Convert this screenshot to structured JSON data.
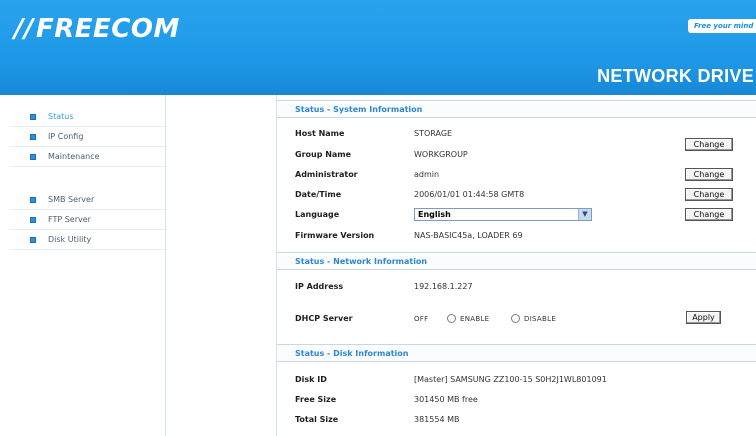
{
  "header": {
    "logo": "FREECOM",
    "tagline": "Free your mind",
    "product": "NETWORK DRIVE",
    "colors": {
      "brand_blue": "#1f9ae8",
      "header_text": "#ffffff"
    }
  },
  "sidebar": {
    "groups": [
      {
        "items": [
          {
            "label": "Status",
            "active": true
          },
          {
            "label": "IP Config",
            "active": false
          },
          {
            "label": "Maintenance",
            "active": false
          }
        ]
      },
      {
        "items": [
          {
            "label": "SMB Server",
            "active": false
          },
          {
            "label": "FTP Server",
            "active": false
          },
          {
            "label": "Disk Utility",
            "active": false
          }
        ]
      }
    ]
  },
  "system": {
    "title": "Status - System Information",
    "host_name": {
      "label": "Host Name",
      "value": "STORAGE",
      "button": "Change"
    },
    "group_name": {
      "label": "Group Name",
      "value": "WORKGROUP"
    },
    "administrator": {
      "label": "Administrator",
      "value": "admin",
      "button": "Change"
    },
    "datetime": {
      "label": "Date/Time",
      "value": "2006/01/01 01:44:58 GMT8",
      "button": "Change"
    },
    "language": {
      "label": "Language",
      "value": "English",
      "button": "Change"
    },
    "firmware": {
      "label": "Firmware Version",
      "value": "NAS-BASIC45a, LOADER 69"
    }
  },
  "network": {
    "title": "Status - Network Information",
    "ip": {
      "label": "IP Address",
      "value": "192.168.1.227"
    },
    "dhcp": {
      "label": "DHCP Server",
      "state": "OFF",
      "enable": "ENABLE",
      "disable": "DISABLE",
      "button": "Apply"
    }
  },
  "disk": {
    "title": "Status - Disk Information",
    "disk_id": {
      "label": "Disk ID",
      "value": "[Master] SAMSUNG ZZ100-15 S0H2J1WL801091"
    },
    "free_size": {
      "label": "Free Size",
      "value": "301450 MB free"
    },
    "total_size": {
      "label": "Total Size",
      "value": "381554 MB"
    }
  }
}
